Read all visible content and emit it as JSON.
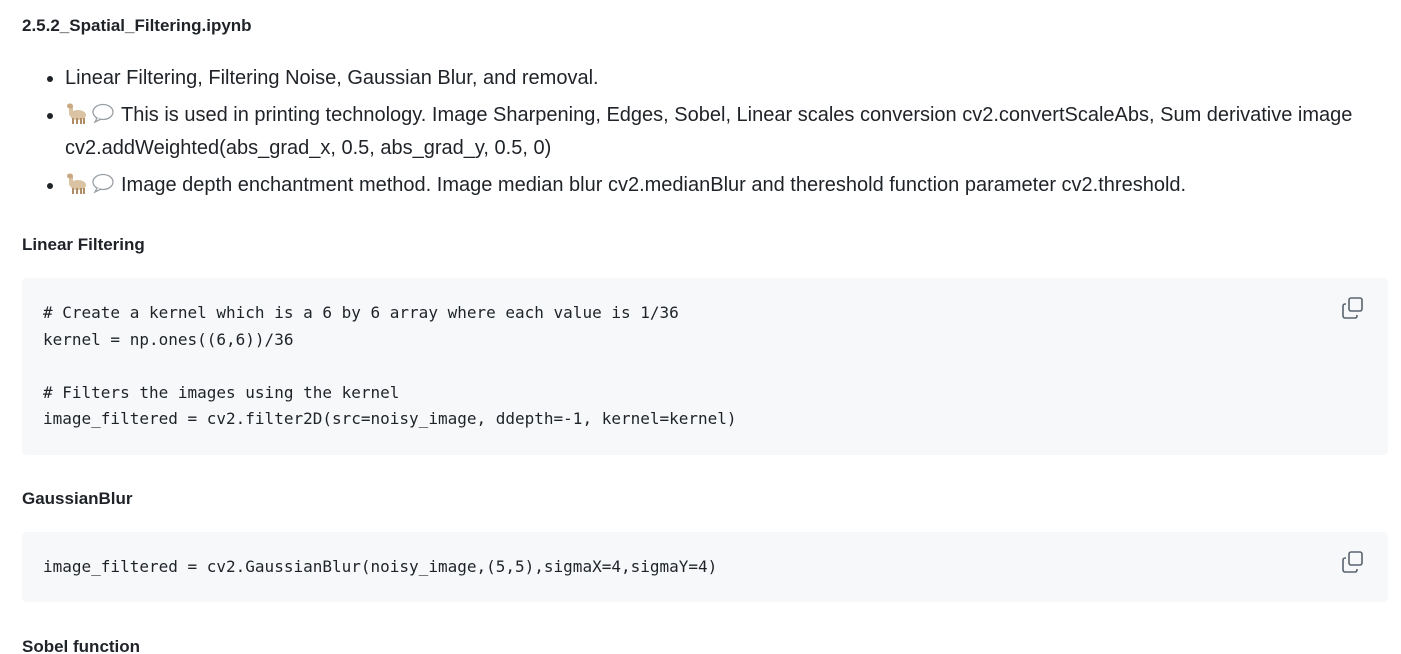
{
  "file_title": "2.5.2_Spatial_Filtering.ipynb",
  "bullets": {
    "b1": "Linear Filtering, Filtering Noise, Gaussian Blur, and removal.",
    "b2": "This is used in printing technology. Image Sharpening, Edges, Sobel, Linear scales conversion cv2.convertScaleAbs, Sum derivative image cv2.addWeighted(abs_grad_x, 0.5, abs_grad_y, 0.5, 0)",
    "b3": "Image depth enchantment method. Image median blur cv2.medianBlur and thereshold function parameter cv2.threshold.",
    "emoji_icon": "llama-icon",
    "bubble_icon": "speech-bubble-icon"
  },
  "sections": {
    "linear": {
      "heading": "Linear Filtering",
      "code": "# Create a kernel which is a 6 by 6 array where each value is 1/36\nkernel = np.ones((6,6))/36\n\n# Filters the images using the kernel\nimage_filtered = cv2.filter2D(src=noisy_image, ddepth=-1, kernel=kernel)"
    },
    "gaussian": {
      "heading": "GaussianBlur",
      "code": "image_filtered = cv2.GaussianBlur(noisy_image,(5,5),sigmaX=4,sigmaY=4)"
    },
    "sobel": {
      "heading": "Sobel function"
    }
  },
  "copy_icon": "copy-icon",
  "colors": {
    "code_bg": "#f6f8fa",
    "text": "#1f2328"
  }
}
